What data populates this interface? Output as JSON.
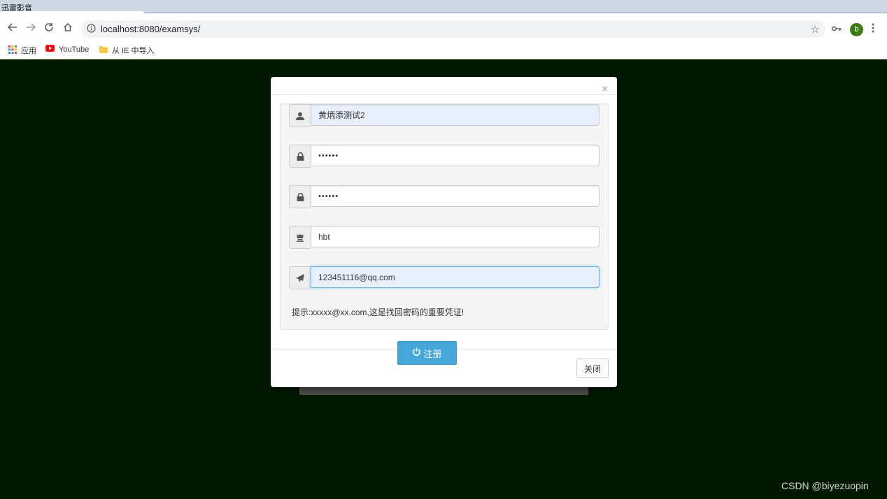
{
  "window": {
    "title": "迅雷影音"
  },
  "browser": {
    "url": "localhost:8080/examsys/",
    "profile_initial": "b",
    "bookmarks": [
      {
        "label": "应用",
        "icon": "apps-grid-icon"
      },
      {
        "label": "YouTube",
        "icon": "youtube-icon"
      },
      {
        "label": "从 IE 中导入",
        "icon": "folder-icon"
      }
    ]
  },
  "modal": {
    "close_symbol": "×",
    "fields": [
      {
        "icon": "user-icon",
        "value": "黄炳添测试2",
        "type": "text"
      },
      {
        "icon": "lock-icon",
        "value": "••••••",
        "type": "password"
      },
      {
        "icon": "lock-icon",
        "value": "••••••",
        "type": "password"
      },
      {
        "icon": "chess-king-icon",
        "value": "hbt",
        "type": "text"
      },
      {
        "icon": "send-icon",
        "value": "123451116@qq.com",
        "type": "email"
      }
    ],
    "hint": "提示:xxxxx@xx.com,这是找回密码的重要凭证!",
    "register_label": "注册",
    "close_label": "关闭"
  },
  "watermark": "CSDN @biyezuopin",
  "colors": {
    "page_bg": "#001800",
    "primary_button": "#46a8d8",
    "profile_avatar": "#3c7d12",
    "youtube_red": "#ff0000"
  }
}
